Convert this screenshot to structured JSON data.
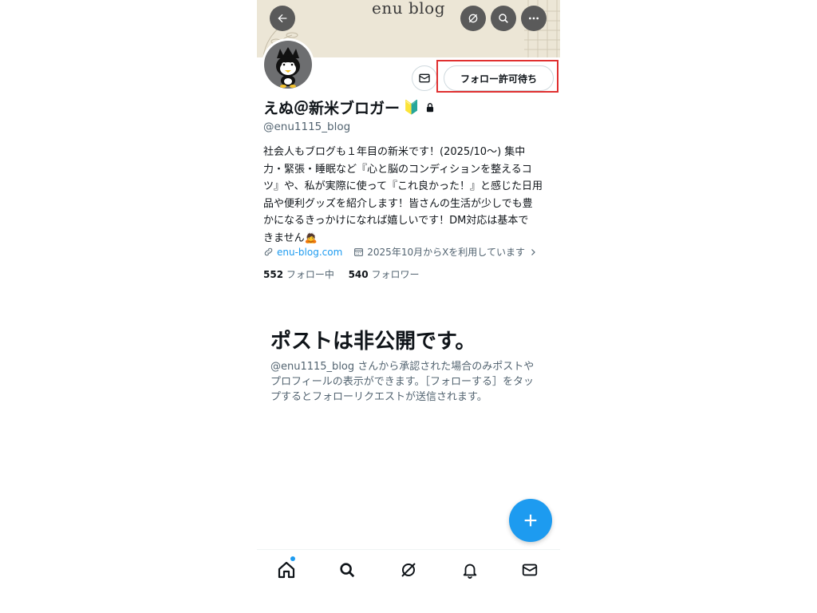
{
  "banner": {
    "title": "enu blog"
  },
  "header": {
    "back_icon": "arrow-left-icon",
    "grok_icon": "grok-icon",
    "search_icon": "search-icon",
    "more_icon": "more-horizontal-icon"
  },
  "profile": {
    "name": "えぬ＠新米ブロガー",
    "beginner_mark": "🔰",
    "handle": "@enu1115_blog",
    "bio_lines": [
      "社会人もブログも１年目の新米です！(2025/10〜) 集中",
      "力・緊張・睡眠など『心と脳のコンディションを整えるコ",
      "ツ』や、私が実際に使って『これ良かった！』と感じた日用",
      "品や便利グッズを紹介します！皆さんの生活が少しでも豊",
      "かになるきっかけになれば嬉しいです！DM対応は基本で",
      "きません🙇"
    ],
    "website": "enu-blog.com",
    "joined": "2025年10月からXを利用しています",
    "following_count": "552",
    "following_label": "フォロー中",
    "followers_count": "540",
    "followers_label": "フォロワー"
  },
  "actions": {
    "follow_status": "フォロー許可待ち",
    "message_icon": "mail-icon"
  },
  "private": {
    "title": "ポストは非公開です。",
    "desc_lines": [
      "@enu1115_blog さんから承認された場合のみポストや",
      "プロフィールの表示ができます。［フォローする］をタッ",
      "プするとフォローリクエストが送信されます。"
    ]
  },
  "colors": {
    "accent": "#1d9bf0",
    "highlight": "#e03030",
    "text": "#0f1419",
    "muted": "#536471"
  },
  "tabs": [
    "home-icon",
    "search-icon",
    "grok-icon",
    "bell-icon",
    "mail-icon"
  ]
}
